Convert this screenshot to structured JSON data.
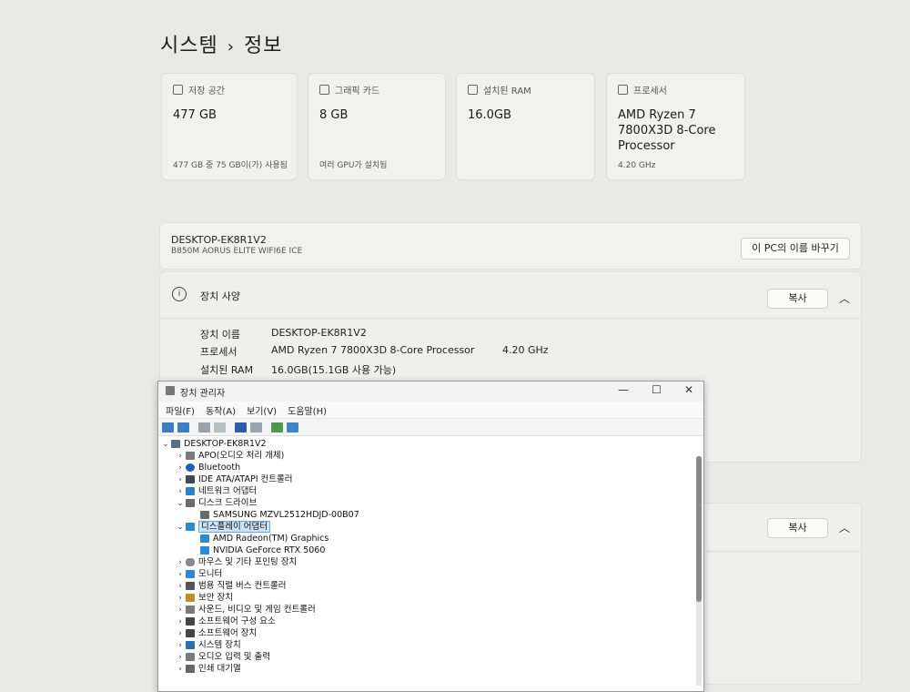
{
  "breadcrumb": {
    "parent": "시스템",
    "separator": "›",
    "current": "정보"
  },
  "cards": [
    {
      "label": "저장 공간",
      "value": "477 GB",
      "sub": "477 GB 중 75 GB이(가) 사용됨"
    },
    {
      "label": "그래픽 카드",
      "value": "8 GB",
      "sub": "여러 GPU가 설치됨"
    },
    {
      "label": "설치된 RAM",
      "value": "16.0GB",
      "sub": ""
    },
    {
      "label": "프로세서",
      "value": "AMD Ryzen 7 7800X3D 8-Core Processor",
      "sub": "4.20 GHz"
    }
  ],
  "pc": {
    "name": "DESKTOP-EK8R1V2",
    "model": "B850M AORUS ELITE WIFI6E ICE",
    "rename_label": "이 PC의 이름 바꾸기"
  },
  "specs": {
    "title": "장치 사양",
    "copy_label": "복사",
    "rows": [
      {
        "label": "장치 이름",
        "value": "DESKTOP-EK8R1V2",
        "extra": ""
      },
      {
        "label": "프로세서",
        "value": "AMD Ryzen 7 7800X3D 8-Core Processor",
        "extra": "4.20 GHz"
      },
      {
        "label": "설치된 RAM",
        "value": "16.0GB(15.1GB 사용 가능)",
        "extra": ""
      }
    ]
  },
  "lower": {
    "copy_label": "복사"
  },
  "device_manager": {
    "title": "장치 관리자",
    "controls": {
      "minimize": "—",
      "maximize": "☐",
      "close": "✕"
    },
    "menu": [
      "파일(F)",
      "동작(A)",
      "보기(V)",
      "도움말(H)"
    ],
    "tree": [
      {
        "label": "DESKTOP-EK8R1V2",
        "level": 0,
        "arrow": "⌄",
        "icon": "computer-icon"
      },
      {
        "label": "APO(오디오 처리 개체)",
        "level": 1,
        "arrow": "›",
        "icon": "audio-icon"
      },
      {
        "label": "Bluetooth",
        "level": 1,
        "arrow": "›",
        "icon": "bluetooth-icon"
      },
      {
        "label": "IDE ATA/ATAPI 컨트롤러",
        "level": 1,
        "arrow": "›",
        "icon": "controller-icon"
      },
      {
        "label": "네트워크 어댑터",
        "level": 1,
        "arrow": "›",
        "icon": "network-icon"
      },
      {
        "label": "디스크 드라이브",
        "level": 1,
        "arrow": "⌄",
        "icon": "disk-icon"
      },
      {
        "label": "SAMSUNG MZVL2512HDJD-00B07",
        "level": 2,
        "arrow": "",
        "icon": "disk-icon"
      },
      {
        "label": "디스플레이 어댑터",
        "level": 1,
        "arrow": "⌄",
        "icon": "display-icon",
        "selected": true
      },
      {
        "label": "AMD Radeon(TM) Graphics",
        "level": 2,
        "arrow": "",
        "icon": "display-icon"
      },
      {
        "label": "NVIDIA GeForce RTX 5060",
        "level": 2,
        "arrow": "",
        "icon": "display-icon"
      },
      {
        "label": "마우스 및 기타 포인팅 장치",
        "level": 1,
        "arrow": "›",
        "icon": "mouse-icon"
      },
      {
        "label": "모니터",
        "level": 1,
        "arrow": "›",
        "icon": "monitor-icon"
      },
      {
        "label": "범용 직렬 버스 컨트롤러",
        "level": 1,
        "arrow": "›",
        "icon": "usb-icon"
      },
      {
        "label": "보안 장치",
        "level": 1,
        "arrow": "›",
        "icon": "security-icon"
      },
      {
        "label": "사운드, 비디오 및 게임 컨트롤러",
        "level": 1,
        "arrow": "›",
        "icon": "sound-icon"
      },
      {
        "label": "소프트웨어 구성 요소",
        "level": 1,
        "arrow": "›",
        "icon": "software-icon"
      },
      {
        "label": "소프트웨어 장치",
        "level": 1,
        "arrow": "›",
        "icon": "software-icon"
      },
      {
        "label": "시스템 장치",
        "level": 1,
        "arrow": "›",
        "icon": "system-icon"
      },
      {
        "label": "오디오 입력 및 출력",
        "level": 1,
        "arrow": "›",
        "icon": "audio-icon"
      },
      {
        "label": "인쇄 대기열",
        "level": 1,
        "arrow": "›",
        "icon": "printer-icon"
      }
    ]
  }
}
